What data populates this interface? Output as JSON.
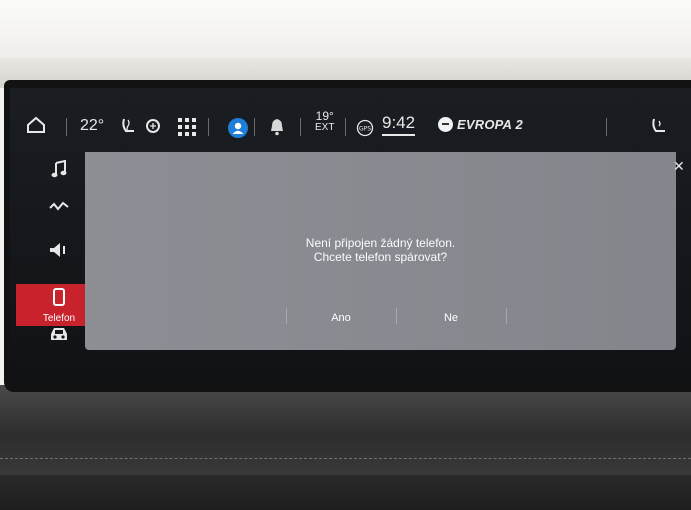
{
  "status_bar": {
    "cabin_temp": "22°",
    "outside_temp_value": "19°",
    "outside_temp_label": "EXT",
    "gps_label": "GPS",
    "time": "9:42",
    "radio_station": "EVROPA 2"
  },
  "sidebar": {
    "items": [
      {
        "icon": "music-icon"
      },
      {
        "icon": "navigation-icon"
      },
      {
        "icon": "volume-icon"
      },
      {
        "icon": "phone-icon",
        "label": "Telefon",
        "active": true
      },
      {
        "icon": "car-icon"
      }
    ]
  },
  "dialog": {
    "line1": "Není připojen žádný telefon.",
    "line2": "Chcete telefon spárovat?",
    "yes_label": "Ano",
    "no_label": "Ne"
  },
  "colors": {
    "active_accent": "#c8232c",
    "dialog_bg": "#888b91",
    "profile_blue": "#1f7fd6"
  }
}
